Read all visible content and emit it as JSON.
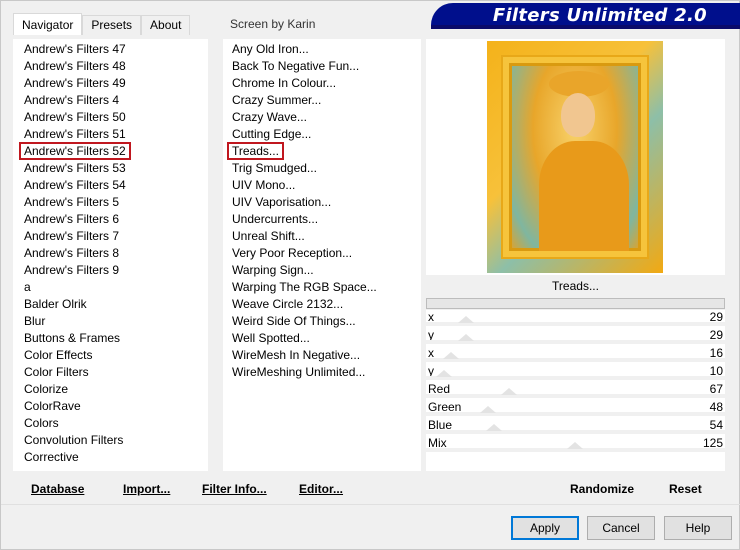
{
  "tabs": [
    {
      "label": "Navigator",
      "active": true
    },
    {
      "label": "Presets",
      "active": false
    },
    {
      "label": "About",
      "active": false
    }
  ],
  "screen_label": "Screen by Karin",
  "banner_title": "Filters Unlimited 2.0",
  "categories": [
    "Andrew's Filters 47",
    "Andrew's Filters 48",
    "Andrew's Filters 49",
    "Andrew's Filters 4",
    "Andrew's Filters 50",
    "Andrew's Filters 51",
    "Andrew's Filters 52",
    "Andrew's Filters 53",
    "Andrew's Filters 54",
    "Andrew's Filters 5",
    "Andrew's Filters 6",
    "Andrew's Filters 7",
    "Andrew's Filters 8",
    "Andrew's Filters 9",
    "a",
    "Balder Olrik",
    "Blur",
    "Buttons & Frames",
    "Color Effects",
    "Color Filters",
    "Colorize",
    "ColorRave",
    "Colors",
    "Convolution Filters",
    "Corrective"
  ],
  "selected_category_index": 6,
  "filters": [
    "Any Old Iron...",
    "Back To Negative Fun...",
    "Chrome In Colour...",
    "Crazy Summer...",
    "Crazy Wave...",
    "Cutting Edge...",
    "Treads...",
    "Trig Smudged...",
    "UIV Mono...",
    "UIV Vaporisation...",
    "Undercurrents...",
    "Unreal Shift...",
    "Very Poor Reception...",
    "Warping Sign...",
    "Warping The RGB Space...",
    "Weave Circle 2132...",
    "Weird Side Of Things...",
    "Well Spotted...",
    "WireMesh In Negative...",
    "WireMeshing Unlimited..."
  ],
  "selected_filter_index": 6,
  "preview_filter_name": "Treads...",
  "sliders": [
    {
      "label": "x",
      "value": "29",
      "level": 29
    },
    {
      "label": "y",
      "value": "29",
      "level": 29
    },
    {
      "label": "x",
      "value": "16",
      "level": 16
    },
    {
      "label": "y",
      "value": "10",
      "level": 10
    },
    {
      "label": "Red",
      "value": "67",
      "level": 67
    },
    {
      "label": "Green",
      "value": "48",
      "level": 48
    },
    {
      "label": "Blue",
      "value": "54",
      "level": 54
    },
    {
      "label": "Mix",
      "value": "125",
      "level": 125
    }
  ],
  "bottom": {
    "database": "Database",
    "import": "Import...",
    "filter_info": "Filter Info...",
    "editor": "Editor...",
    "randomize": "Randomize",
    "reset": "Reset"
  },
  "buttons": {
    "apply": "Apply",
    "cancel": "Cancel",
    "help": "Help"
  },
  "colors": {
    "banner_bg": "#000f8c",
    "selection_outline": "#c0171f"
  }
}
